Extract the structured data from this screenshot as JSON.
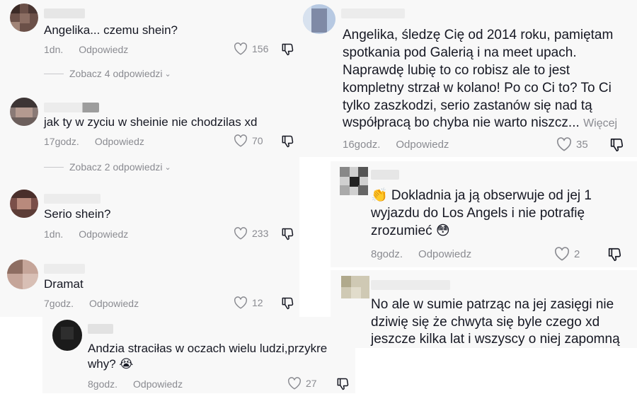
{
  "actions": {
    "reply_label": "Odpowiedz"
  },
  "comments": [
    {
      "text": "Angelika... czemu shein?",
      "time": "1dn.",
      "likes": "156",
      "view_replies": "Zobacz 4 odpowiedzi"
    },
    {
      "text": "jak ty w zyciu w sheinie nie chodzilas xd",
      "time": "17godz.",
      "likes": "70",
      "view_replies": "Zobacz 2 odpowiedzi"
    },
    {
      "text": "Serio shein?",
      "time": "1dn.",
      "likes": "233"
    },
    {
      "text": "Dramat",
      "time": "7godz.",
      "likes": "12"
    },
    {
      "lines": [
        "Andzia straciłas w oczach wielu ludzi,przykre",
        "why? 😭"
      ],
      "time": "8godz.",
      "likes": "27"
    },
    {
      "lines": [
        "Angelika, śledzę Cię od 2014 roku, pamiętam",
        "spotkania pod Galerią i na meet upach.",
        "Naprawdę lubię to co robisz ale to jest",
        "kompletny strzał w kolano! Po co Ci to? To Ci",
        "tylko zaszkodzi, serio zastanów się nad tą",
        "współpracą bo chyba nie warto niszcz..."
      ],
      "more_label": "Więcej",
      "time": "16godz.",
      "likes": "35"
    },
    {
      "lines": [
        "👏 Dokladnia ja ją obserwuje od jej 1",
        "wyjazdu do Los Angels i nie potrafię",
        "zrozumieć 😳"
      ],
      "time": "8godz.",
      "likes": "2"
    },
    {
      "lines": [
        "No ale w sumie patrząc na jej zasięgi nie",
        "dziwię się że chwyta się byle czego xd",
        "jeszcze kilka lat i wszyscy o niej zapomną"
      ]
    }
  ],
  "colors": {
    "text": "#161823",
    "secondary": "#8a8b91",
    "panel_bg": "#f8f8f8"
  },
  "icons": {
    "like": "heart-outline-icon",
    "dislike": "thumbs-down-icon",
    "expand": "chevron-down-icon"
  }
}
